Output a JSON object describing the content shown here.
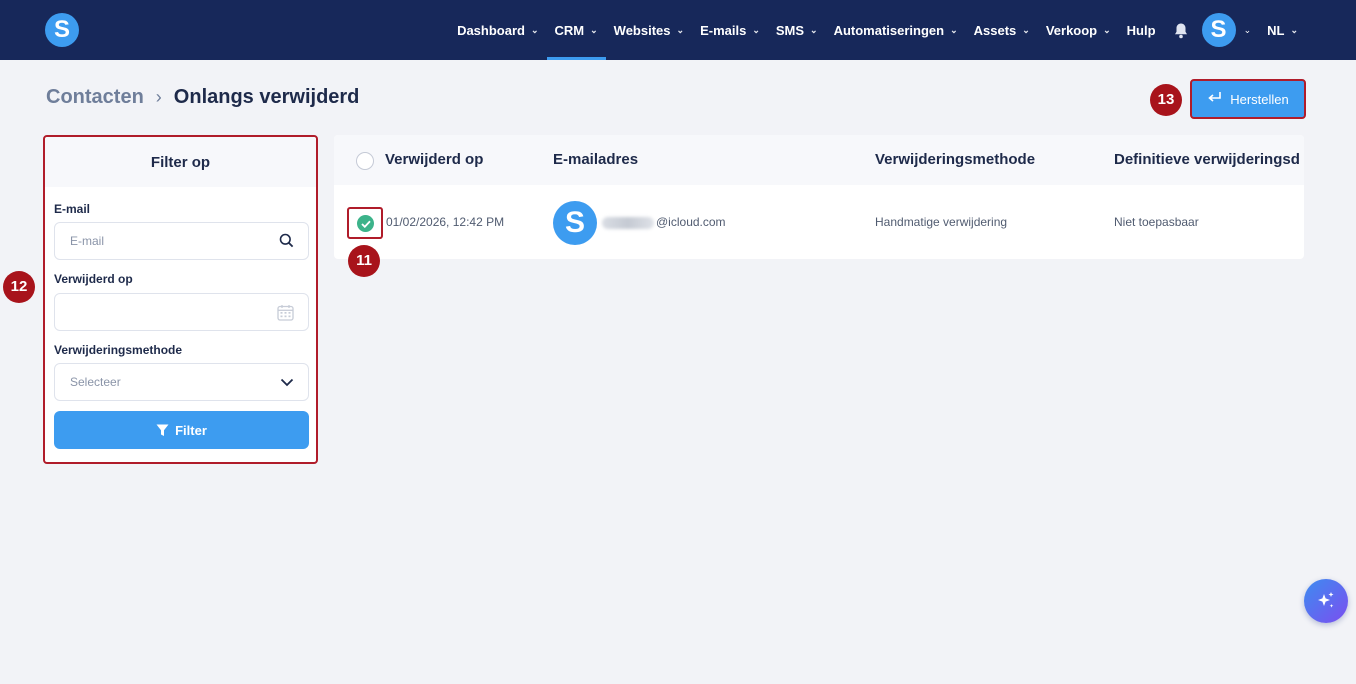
{
  "nav": {
    "items": [
      {
        "label": "Dashboard",
        "dropdown": true,
        "active": false
      },
      {
        "label": "CRM",
        "dropdown": true,
        "active": true
      },
      {
        "label": "Websites",
        "dropdown": true,
        "active": false
      },
      {
        "label": "E-mails",
        "dropdown": true,
        "active": false
      },
      {
        "label": "SMS",
        "dropdown": true,
        "active": false
      },
      {
        "label": "Automatiseringen",
        "dropdown": true,
        "active": false
      },
      {
        "label": "Assets",
        "dropdown": true,
        "active": false
      },
      {
        "label": "Verkoop",
        "dropdown": true,
        "active": false
      },
      {
        "label": "Hulp",
        "dropdown": false,
        "active": false
      }
    ],
    "logo_letter": "S",
    "avatar_letter": "S",
    "language": "NL"
  },
  "breadcrumb": {
    "parent": "Contacten",
    "current": "Onlangs verwijderd"
  },
  "actions": {
    "restore_label": "Herstellen"
  },
  "annotations": {
    "row_checkbox": "11",
    "filter_panel": "12",
    "restore_button": "13"
  },
  "filter": {
    "title": "Filter op",
    "email_label": "E-mail",
    "email_placeholder": "E-mail",
    "deleted_on_label": "Verwijderd op",
    "method_label": "Verwijderingsmethode",
    "method_placeholder": "Selecteer",
    "button_label": "Filter"
  },
  "table": {
    "columns": [
      "Verwijderd op",
      "E-mailadres",
      "Verwijderingsmethode",
      "Definitieve verwijderingsd"
    ],
    "rows": [
      {
        "selected": true,
        "deleted_on": "01/02/2026, 12:42 PM",
        "avatar_letter": "S",
        "email_domain": "@icloud.com",
        "method": "Handmatige verwijdering",
        "final_deletion": "Niet toepasbaar"
      }
    ]
  },
  "colors": {
    "nav_bg": "#17285a",
    "accent": "#3d9cf0",
    "highlight": "#b01c2a",
    "success": "#3cb38a"
  }
}
